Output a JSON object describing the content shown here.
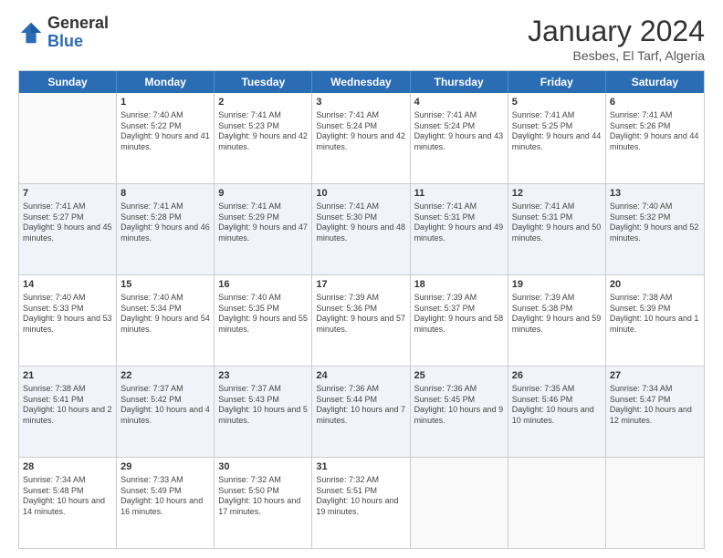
{
  "logo": {
    "general": "General",
    "blue": "Blue"
  },
  "header": {
    "month": "January 2024",
    "location": "Besbes, El Tarf, Algeria"
  },
  "days": [
    "Sunday",
    "Monday",
    "Tuesday",
    "Wednesday",
    "Thursday",
    "Friday",
    "Saturday"
  ],
  "weeks": [
    [
      {
        "day": "",
        "sunrise": "",
        "sunset": "",
        "daylight": ""
      },
      {
        "day": "1",
        "sunrise": "Sunrise: 7:40 AM",
        "sunset": "Sunset: 5:22 PM",
        "daylight": "Daylight: 9 hours and 41 minutes."
      },
      {
        "day": "2",
        "sunrise": "Sunrise: 7:41 AM",
        "sunset": "Sunset: 5:23 PM",
        "daylight": "Daylight: 9 hours and 42 minutes."
      },
      {
        "day": "3",
        "sunrise": "Sunrise: 7:41 AM",
        "sunset": "Sunset: 5:24 PM",
        "daylight": "Daylight: 9 hours and 42 minutes."
      },
      {
        "day": "4",
        "sunrise": "Sunrise: 7:41 AM",
        "sunset": "Sunset: 5:24 PM",
        "daylight": "Daylight: 9 hours and 43 minutes."
      },
      {
        "day": "5",
        "sunrise": "Sunrise: 7:41 AM",
        "sunset": "Sunset: 5:25 PM",
        "daylight": "Daylight: 9 hours and 44 minutes."
      },
      {
        "day": "6",
        "sunrise": "Sunrise: 7:41 AM",
        "sunset": "Sunset: 5:26 PM",
        "daylight": "Daylight: 9 hours and 44 minutes."
      }
    ],
    [
      {
        "day": "7",
        "sunrise": "Sunrise: 7:41 AM",
        "sunset": "Sunset: 5:27 PM",
        "daylight": "Daylight: 9 hours and 45 minutes."
      },
      {
        "day": "8",
        "sunrise": "Sunrise: 7:41 AM",
        "sunset": "Sunset: 5:28 PM",
        "daylight": "Daylight: 9 hours and 46 minutes."
      },
      {
        "day": "9",
        "sunrise": "Sunrise: 7:41 AM",
        "sunset": "Sunset: 5:29 PM",
        "daylight": "Daylight: 9 hours and 47 minutes."
      },
      {
        "day": "10",
        "sunrise": "Sunrise: 7:41 AM",
        "sunset": "Sunset: 5:30 PM",
        "daylight": "Daylight: 9 hours and 48 minutes."
      },
      {
        "day": "11",
        "sunrise": "Sunrise: 7:41 AM",
        "sunset": "Sunset: 5:31 PM",
        "daylight": "Daylight: 9 hours and 49 minutes."
      },
      {
        "day": "12",
        "sunrise": "Sunrise: 7:41 AM",
        "sunset": "Sunset: 5:31 PM",
        "daylight": "Daylight: 9 hours and 50 minutes."
      },
      {
        "day": "13",
        "sunrise": "Sunrise: 7:40 AM",
        "sunset": "Sunset: 5:32 PM",
        "daylight": "Daylight: 9 hours and 52 minutes."
      }
    ],
    [
      {
        "day": "14",
        "sunrise": "Sunrise: 7:40 AM",
        "sunset": "Sunset: 5:33 PM",
        "daylight": "Daylight: 9 hours and 53 minutes."
      },
      {
        "day": "15",
        "sunrise": "Sunrise: 7:40 AM",
        "sunset": "Sunset: 5:34 PM",
        "daylight": "Daylight: 9 hours and 54 minutes."
      },
      {
        "day": "16",
        "sunrise": "Sunrise: 7:40 AM",
        "sunset": "Sunset: 5:35 PM",
        "daylight": "Daylight: 9 hours and 55 minutes."
      },
      {
        "day": "17",
        "sunrise": "Sunrise: 7:39 AM",
        "sunset": "Sunset: 5:36 PM",
        "daylight": "Daylight: 9 hours and 57 minutes."
      },
      {
        "day": "18",
        "sunrise": "Sunrise: 7:39 AM",
        "sunset": "Sunset: 5:37 PM",
        "daylight": "Daylight: 9 hours and 58 minutes."
      },
      {
        "day": "19",
        "sunrise": "Sunrise: 7:39 AM",
        "sunset": "Sunset: 5:38 PM",
        "daylight": "Daylight: 9 hours and 59 minutes."
      },
      {
        "day": "20",
        "sunrise": "Sunrise: 7:38 AM",
        "sunset": "Sunset: 5:39 PM",
        "daylight": "Daylight: 10 hours and 1 minute."
      }
    ],
    [
      {
        "day": "21",
        "sunrise": "Sunrise: 7:38 AM",
        "sunset": "Sunset: 5:41 PM",
        "daylight": "Daylight: 10 hours and 2 minutes."
      },
      {
        "day": "22",
        "sunrise": "Sunrise: 7:37 AM",
        "sunset": "Sunset: 5:42 PM",
        "daylight": "Daylight: 10 hours and 4 minutes."
      },
      {
        "day": "23",
        "sunrise": "Sunrise: 7:37 AM",
        "sunset": "Sunset: 5:43 PM",
        "daylight": "Daylight: 10 hours and 5 minutes."
      },
      {
        "day": "24",
        "sunrise": "Sunrise: 7:36 AM",
        "sunset": "Sunset: 5:44 PM",
        "daylight": "Daylight: 10 hours and 7 minutes."
      },
      {
        "day": "25",
        "sunrise": "Sunrise: 7:36 AM",
        "sunset": "Sunset: 5:45 PM",
        "daylight": "Daylight: 10 hours and 9 minutes."
      },
      {
        "day": "26",
        "sunrise": "Sunrise: 7:35 AM",
        "sunset": "Sunset: 5:46 PM",
        "daylight": "Daylight: 10 hours and 10 minutes."
      },
      {
        "day": "27",
        "sunrise": "Sunrise: 7:34 AM",
        "sunset": "Sunset: 5:47 PM",
        "daylight": "Daylight: 10 hours and 12 minutes."
      }
    ],
    [
      {
        "day": "28",
        "sunrise": "Sunrise: 7:34 AM",
        "sunset": "Sunset: 5:48 PM",
        "daylight": "Daylight: 10 hours and 14 minutes."
      },
      {
        "day": "29",
        "sunrise": "Sunrise: 7:33 AM",
        "sunset": "Sunset: 5:49 PM",
        "daylight": "Daylight: 10 hours and 16 minutes."
      },
      {
        "day": "30",
        "sunrise": "Sunrise: 7:32 AM",
        "sunset": "Sunset: 5:50 PM",
        "daylight": "Daylight: 10 hours and 17 minutes."
      },
      {
        "day": "31",
        "sunrise": "Sunrise: 7:32 AM",
        "sunset": "Sunset: 5:51 PM",
        "daylight": "Daylight: 10 hours and 19 minutes."
      },
      {
        "day": "",
        "sunrise": "",
        "sunset": "",
        "daylight": ""
      },
      {
        "day": "",
        "sunrise": "",
        "sunset": "",
        "daylight": ""
      },
      {
        "day": "",
        "sunrise": "",
        "sunset": "",
        "daylight": ""
      }
    ]
  ]
}
